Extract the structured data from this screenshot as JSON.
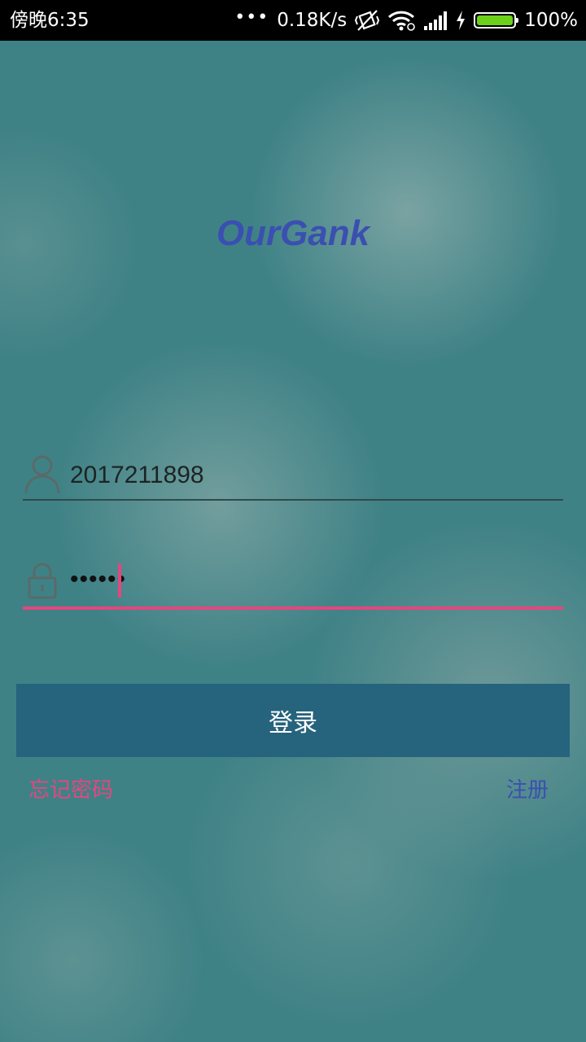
{
  "status_bar": {
    "time": "傍晚6:35",
    "dots": "•••",
    "network_speed": "0.18K/s",
    "battery_percent": "100%",
    "battery_level": 1.0,
    "icons": [
      "mute-vibrate-icon",
      "wifi-icon",
      "signal-icon",
      "charging-bolt-icon",
      "battery-icon"
    ]
  },
  "app": {
    "title": "OurGank"
  },
  "login_form": {
    "username_value": "2017211898",
    "password_value": "••••••",
    "login_label": "登录",
    "forgot_password_label": "忘记密码",
    "register_label": "注册"
  },
  "colors": {
    "background": "#3f8286",
    "accent": "#e5467f",
    "title": "#3b4fb0",
    "button": "#26637d",
    "battery_fill": "#6bd11a"
  }
}
